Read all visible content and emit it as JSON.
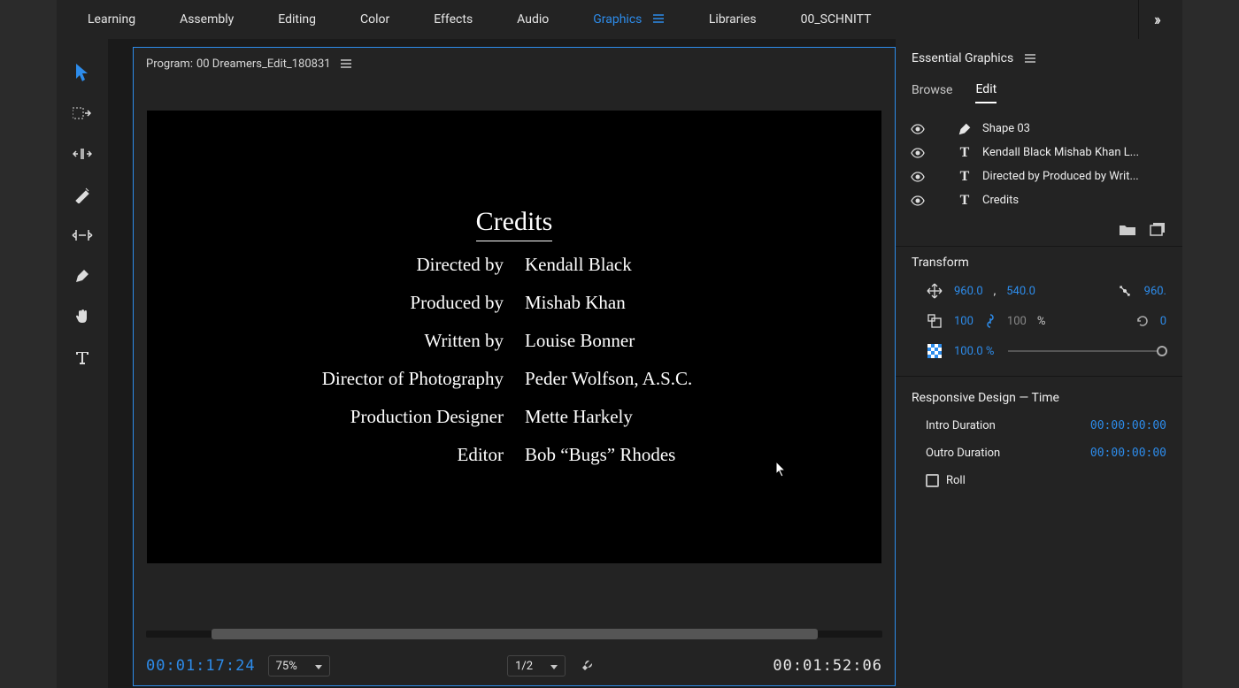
{
  "workspaces": {
    "items": [
      "Learning",
      "Assembly",
      "Editing",
      "Color",
      "Effects",
      "Audio",
      "Graphics",
      "Libraries",
      "00_SCHNITT"
    ],
    "active": "Graphics"
  },
  "program": {
    "title_prefix": "Program:",
    "title": "00 Dreamers_Edit_180831",
    "credits_heading": "Credits",
    "credits": [
      {
        "role": "Directed by",
        "name": "Kendall Black"
      },
      {
        "role": "Produced by",
        "name": "Mishab Khan"
      },
      {
        "role": "Written by",
        "name": "Louise Bonner"
      },
      {
        "role": "Director of Photography",
        "name": "Peder Wolfson, A.S.C."
      },
      {
        "role": "Production Designer",
        "name": "Mette Harkely"
      },
      {
        "role": "Editor",
        "name": "Bob “Bugs” Rhodes"
      }
    ],
    "timecode_in": "00:01:17:24",
    "timecode_out": "00:01:52:06",
    "zoom": "75%",
    "resolution": "1/2"
  },
  "eg": {
    "title": "Essential Graphics",
    "tabs": {
      "browse": "Browse",
      "edit": "Edit",
      "active": "Edit"
    },
    "layers": [
      {
        "type": "shape",
        "label": "Shape 03"
      },
      {
        "type": "text",
        "label": "Kendall Black Mishab Khan L..."
      },
      {
        "type": "text",
        "label": "Directed by Produced by Writ..."
      },
      {
        "type": "text",
        "label": "Credits"
      }
    ],
    "transform": {
      "title": "Transform",
      "pos_x": "960.0",
      "pos_y": "540.0",
      "anchor": "960.",
      "scale_w": "100",
      "scale_h": "100",
      "scale_unit": "%",
      "rotation": "0",
      "opacity": "100.0 %"
    },
    "responsive": {
      "title": "Responsive Design — Time",
      "intro_label": "Intro Duration",
      "intro_val": "00:00:00:00",
      "outro_label": "Outro Duration",
      "outro_val": "00:00:00:00",
      "roll_label": "Roll"
    }
  }
}
